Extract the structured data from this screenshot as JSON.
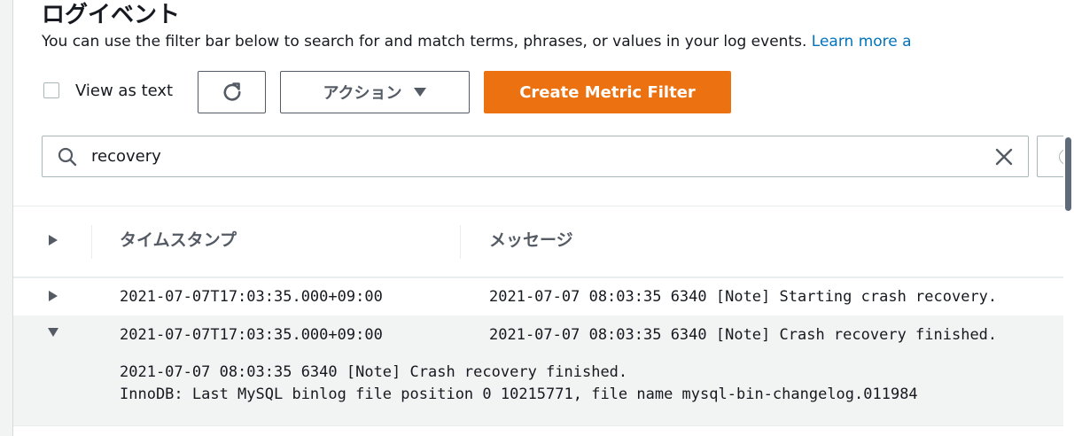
{
  "header": {
    "title": "ログイベント",
    "description": "You can use the filter bar below to search for and match terms, phrases, or values in your log events.",
    "learn_more": "Learn more a"
  },
  "toolbar": {
    "view_as_text_label": "View as text",
    "view_as_text_checked": false,
    "refresh_icon": "refresh-icon",
    "actions_label": "アクション",
    "actions_icon": "caret-down-icon",
    "create_metric_filter_label": "Create Metric Filter"
  },
  "search": {
    "value": "recovery",
    "search_icon": "search-icon",
    "clear_icon": "close-icon"
  },
  "table": {
    "columns": [
      "タイムスタンプ",
      "メッセージ"
    ],
    "rows": [
      {
        "timestamp": "2021-07-07T17:03:35.000+09:00",
        "message": "2021-07-07 08:03:35 6340 [Note] Starting crash recovery.",
        "expanded": false
      },
      {
        "timestamp": "2021-07-07T17:03:35.000+09:00",
        "message": "2021-07-07 08:03:35 6340 [Note] Crash recovery finished.",
        "expanded": true,
        "detail_lines": [
          "2021-07-07 08:03:35 6340 [Note] Crash recovery finished.",
          "InnoDB: Last MySQL binlog file position 0 10215771, file name mysql-bin-changelog.011984"
        ]
      }
    ]
  },
  "colors": {
    "accent": "#ec7211",
    "link": "#0073bb",
    "text": "#16191f",
    "muted": "#545b64",
    "expanded_row_bg": "#f2f3f3"
  }
}
